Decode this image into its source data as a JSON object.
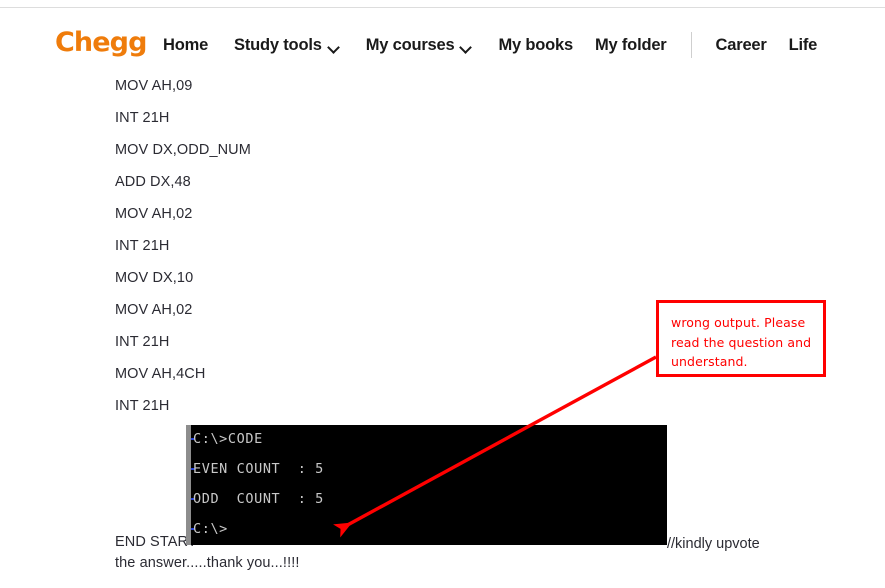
{
  "site": {
    "brand": "Chegg",
    "brand_color": "#ef7c0b",
    "nav": [
      {
        "label": "Home",
        "has_caret": false
      },
      {
        "label": "Study tools",
        "has_caret": true
      },
      {
        "label": "My courses",
        "has_caret": true
      },
      {
        "label": "My books",
        "has_caret": false
      },
      {
        "label": "My folder",
        "has_caret": false
      },
      {
        "label": "Career",
        "has_caret": false
      },
      {
        "label": "Life",
        "has_caret": false
      }
    ]
  },
  "answer": {
    "code_lines": [
      "MOV AH,09",
      "INT 21H",
      "MOV DX,ODD_NUM",
      "ADD DX,48",
      "MOV AH,02",
      "INT 21H",
      "MOV DX,10",
      "MOV AH,02",
      "INT 21H",
      "MOV AH,4CH",
      "INT 21H"
    ],
    "tail_lines": [
      "END START",
      "the answer.....thank you...!!!!"
    ],
    "trailing_comment": "//kindly upvote"
  },
  "terminal": {
    "lines": [
      "C:\\>CODE",
      "EVEN COUNT  : 5",
      "ODD  COUNT  : 5",
      "C:\\>"
    ],
    "background": "#000000",
    "text_color": "#c8c8c8"
  },
  "annotation": {
    "text": "wrong output. Please read the question and understand.",
    "color": "#ff0000"
  }
}
